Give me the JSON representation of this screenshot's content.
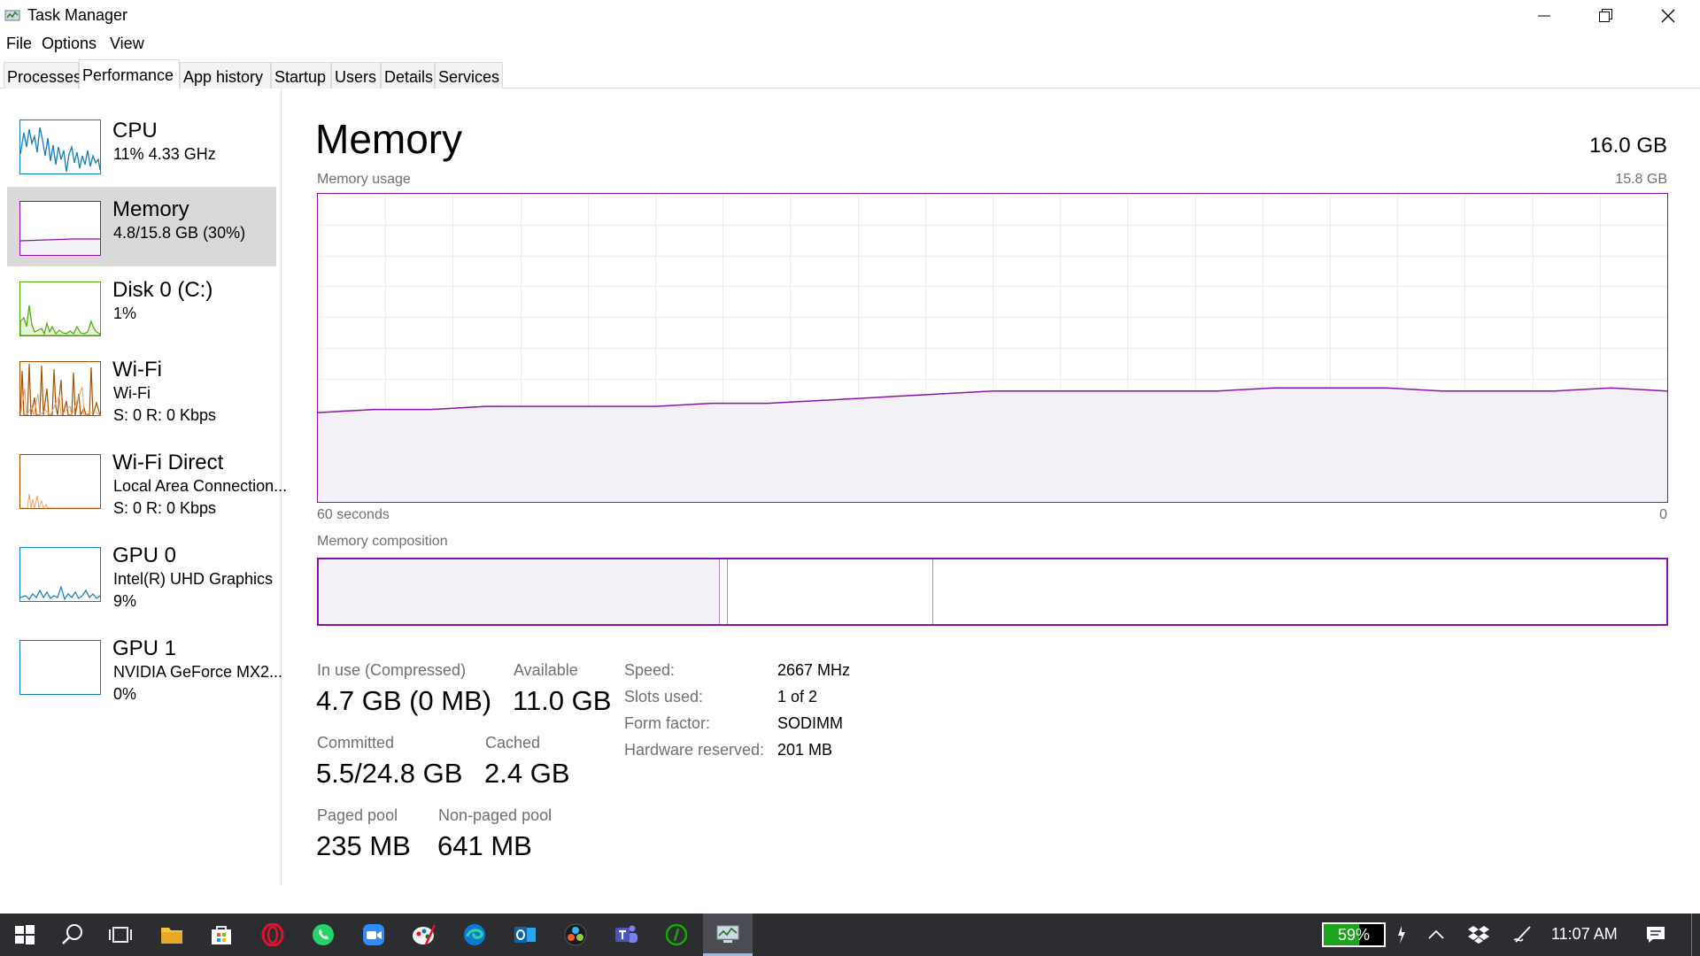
{
  "window": {
    "title": "Task Manager"
  },
  "menu": [
    "File",
    "Options",
    "View"
  ],
  "tabs": [
    {
      "label": "Processes"
    },
    {
      "label": "Performance",
      "active": true
    },
    {
      "label": "App history"
    },
    {
      "label": "Startup"
    },
    {
      "label": "Users"
    },
    {
      "label": "Details"
    },
    {
      "label": "Services"
    }
  ],
  "sidebar": {
    "items": [
      {
        "title": "CPU",
        "lines": [
          "11%  4.33 GHz"
        ],
        "color": "#117dbb"
      },
      {
        "title": "Memory",
        "lines": [
          "4.8/15.8 GB (30%)"
        ],
        "color": "#8b12ae",
        "selected": true
      },
      {
        "title": "Disk 0 (C:)",
        "lines": [
          "1%"
        ],
        "color": "#4da60c"
      },
      {
        "title": "Wi-Fi",
        "lines": [
          "Wi-Fi",
          "S: 0  R: 0 Kbps"
        ],
        "color": "#a74f01"
      },
      {
        "title": "Wi-Fi Direct",
        "lines": [
          "Local Area Connection...",
          "S: 0  R: 0 Kbps"
        ],
        "color": "#a74f01"
      },
      {
        "title": "GPU 0",
        "lines": [
          "Intel(R) UHD Graphics",
          "9%"
        ],
        "color": "#117dbb"
      },
      {
        "title": "GPU 1",
        "lines": [
          "NVIDIA GeForce MX2...",
          "0%"
        ],
        "color": "#117dbb"
      }
    ]
  },
  "main": {
    "title": "Memory",
    "total": "16.0 GB",
    "usage_label": "Memory usage",
    "usage_max": "15.8 GB",
    "time_left": "60 seconds",
    "time_right": "0",
    "composition_label": "Memory composition",
    "composition": {
      "in_use_gb": 4.7,
      "modified_gb": 0.1,
      "standby_gb": 2.4,
      "free_gb": 8.6
    },
    "usage_history_fraction": [
      0.29,
      0.3,
      0.3,
      0.31,
      0.31,
      0.31,
      0.31,
      0.32,
      0.32,
      0.33,
      0.34,
      0.35,
      0.36,
      0.36,
      0.36,
      0.36,
      0.36,
      0.37,
      0.37,
      0.37,
      0.36,
      0.36,
      0.36,
      0.37,
      0.36
    ],
    "stats": {
      "in_use_label": "In use (Compressed)",
      "in_use_value": "4.7 GB (0 MB)",
      "available_label": "Available",
      "available_value": "11.0 GB",
      "committed_label": "Committed",
      "committed_value": "5.5/24.8 GB",
      "cached_label": "Cached",
      "cached_value": "2.4 GB",
      "paged_label": "Paged pool",
      "paged_value": "235 MB",
      "nonpaged_label": "Non-paged pool",
      "nonpaged_value": "641 MB"
    },
    "specs": [
      {
        "label": "Speed:",
        "value": "2667 MHz"
      },
      {
        "label": "Slots used:",
        "value": "1 of 2"
      },
      {
        "label": "Form factor:",
        "value": "SODIMM"
      },
      {
        "label": "Hardware reserved:",
        "value": "201 MB"
      }
    ]
  },
  "taskbar": {
    "icons": [
      "windows-start-icon",
      "search-icon",
      "task-view-icon",
      "file-explorer-icon",
      "microsoft-store-icon",
      "opera-icon",
      "whatsapp-icon",
      "zoom-icon",
      "paint-icon",
      "edge-icon",
      "outlook-icon",
      "davinci-resolve-icon",
      "teams-icon",
      "upwork-icon",
      "task-manager-icon"
    ],
    "battery": "59%",
    "battery_level": 0.59,
    "time": "11:07 AM"
  },
  "colors": {
    "memory": "#8b12ae",
    "memory_fill": "#f4f0f7",
    "cpu": "#117dbb",
    "disk": "#4da60c",
    "wifi": "#a74f01",
    "grid": "#ececec"
  }
}
